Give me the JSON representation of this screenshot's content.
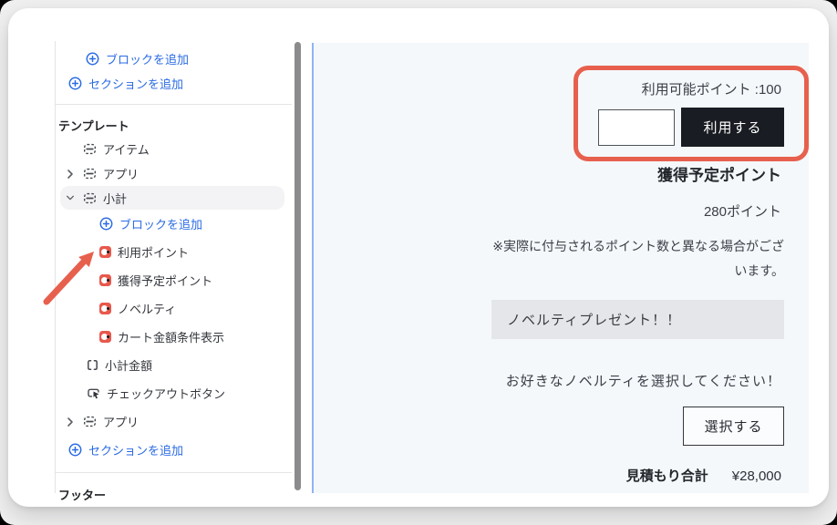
{
  "colors": {
    "accent_blue": "#2b6be4",
    "app_block_red": "#e8584c",
    "annotation_red": "#e7604e",
    "use_button_black": "#191c22",
    "preview_background": "#f5f8fb"
  },
  "sidebar": {
    "actions_top": [
      "ブロックを追加",
      "セクションを追加"
    ],
    "template_header": "テンプレート",
    "footer_header": "フッター",
    "tree": [
      {
        "label": "アイテム",
        "type": "section"
      },
      {
        "label": "アプリ",
        "type": "section-collapsed"
      },
      {
        "label": "小計",
        "type": "section-expanded",
        "selected": true
      },
      {
        "label": "ブロックを追加",
        "type": "add-block"
      },
      {
        "label": "利用ポイント",
        "type": "app-block"
      },
      {
        "label": "獲得予定ポイント",
        "type": "app-block"
      },
      {
        "label": "ノベルティ",
        "type": "app-block"
      },
      {
        "label": "カート金額条件表示",
        "type": "app-block"
      },
      {
        "label": "小計金額",
        "type": "value-block"
      },
      {
        "label": "チェックアウトボタン",
        "type": "button-block"
      },
      {
        "label": "アプリ",
        "type": "section-collapsed"
      },
      {
        "label": "セクションを追加",
        "type": "add-section"
      }
    ]
  },
  "preview": {
    "available_points": "利用可能ポイント :100",
    "points_input_value": "",
    "use_button": "利用する",
    "earn_title": "獲得予定ポイント",
    "earn_points": "280ポイント",
    "note": "※実際に付与されるポイント数と異なる場合がございます。",
    "novelty_banner": "ノベルティプレゼント！！",
    "novelty_prompt": "お好きなノベルティを選択してください！",
    "select_button": "選択する",
    "total_label": "見積もり合計",
    "total_value": "¥28,000"
  }
}
